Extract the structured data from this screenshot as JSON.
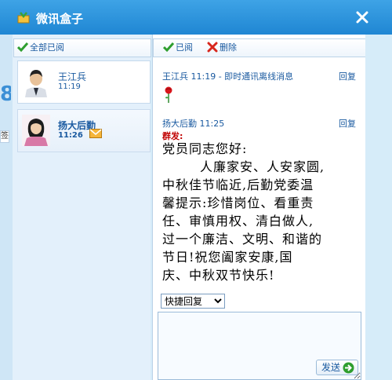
{
  "window": {
    "title": "微讯盒子",
    "close_icon": "close-icon"
  },
  "left_edge": {
    "number": "8",
    "tab": "签"
  },
  "left_toolbar": {
    "mark_all_read": "全部已阅"
  },
  "contacts": [
    {
      "name": "王江兵",
      "time": "11:19",
      "avatar": "male-avatar"
    },
    {
      "name": "扬大后勤",
      "time": "11:26",
      "avatar": "female-avatar",
      "has_unread": true
    }
  ],
  "right_toolbar": {
    "read": "已阅",
    "delete": "删除"
  },
  "messages": [
    {
      "header": "王江兵 11:19 - 即时通讯离线消息",
      "reply": "回复",
      "content_icon": "rose-icon"
    },
    {
      "header": "扬大后勤 11:25",
      "reply": "回复",
      "tag": "群发:",
      "lines": [
        "党员同志您好:",
        "人廉家安、人安家圆,",
        "中秋佳节临近,后勤党委温",
        "馨提示:珍惜岗位、看重责",
        "任、审慎用权、清白做人,",
        "过一个廉洁、文明、和谐的",
        "节日!祝您阖家安康,国",
        "庆、中秋双节快乐!"
      ]
    }
  ],
  "composer": {
    "quick_reply": "快捷回复",
    "input_value": "",
    "send": "发送"
  },
  "colors": {
    "titlebar": "#1f86d3",
    "accent": "#1a5aa0",
    "tag": "#c00000"
  }
}
